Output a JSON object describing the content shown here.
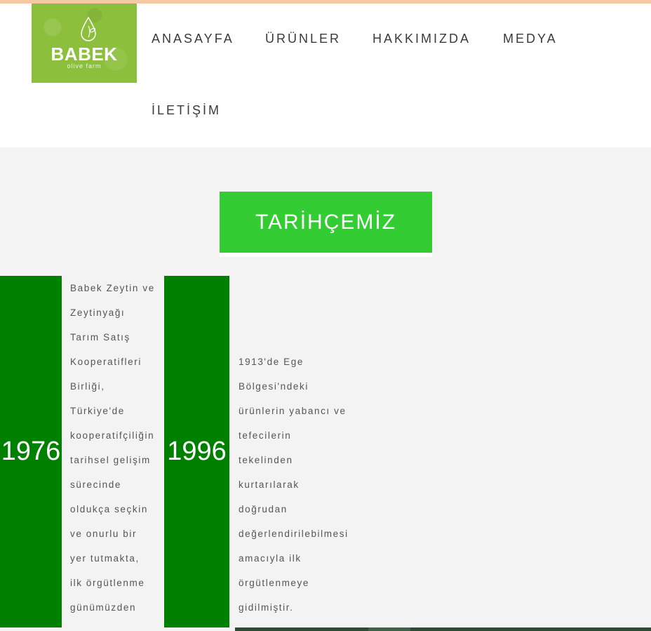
{
  "logo": {
    "brand": "BABEK",
    "tagline": "olive farm"
  },
  "nav": {
    "items": [
      {
        "label": "ANASAYFA"
      },
      {
        "label": "ÜRÜNLER"
      },
      {
        "label": "HAKKIMIZDA"
      },
      {
        "label": "MEDYA"
      },
      {
        "label": "İLETİŞİM"
      }
    ]
  },
  "section": {
    "title": "TARİHÇEMİZ"
  },
  "timeline": [
    {
      "year": "1976",
      "lines": [
        "Babek Zeytin ve",
        "Zeytinyağı",
        "Tarım Satış",
        "Kooperatifleri",
        "Birliği,",
        "Türkiye'de",
        "kooperatifçiliğin",
        "tarihsel gelişim",
        "sürecinde",
        "oldukça seçkin",
        "ve onurlu bir",
        "yer tutmakta,",
        "ilk örgütlenme",
        "günümüzden"
      ]
    },
    {
      "year": "1996",
      "lines": [
        "1913'de Ege",
        "Bölgesi'ndeki",
        "ürünlerin yabancı ve",
        "tefecilerin",
        "tekelinden",
        "kurtarılarak",
        "doğrudan",
        "değerlendirilebilmesi",
        "amacıyla ilk",
        "örgütlenmeye",
        "gidilmiştir."
      ]
    }
  ],
  "colors": {
    "brand_green": "#8cbf3c",
    "title_green": "#33cc33",
    "year_green": "#008000"
  }
}
